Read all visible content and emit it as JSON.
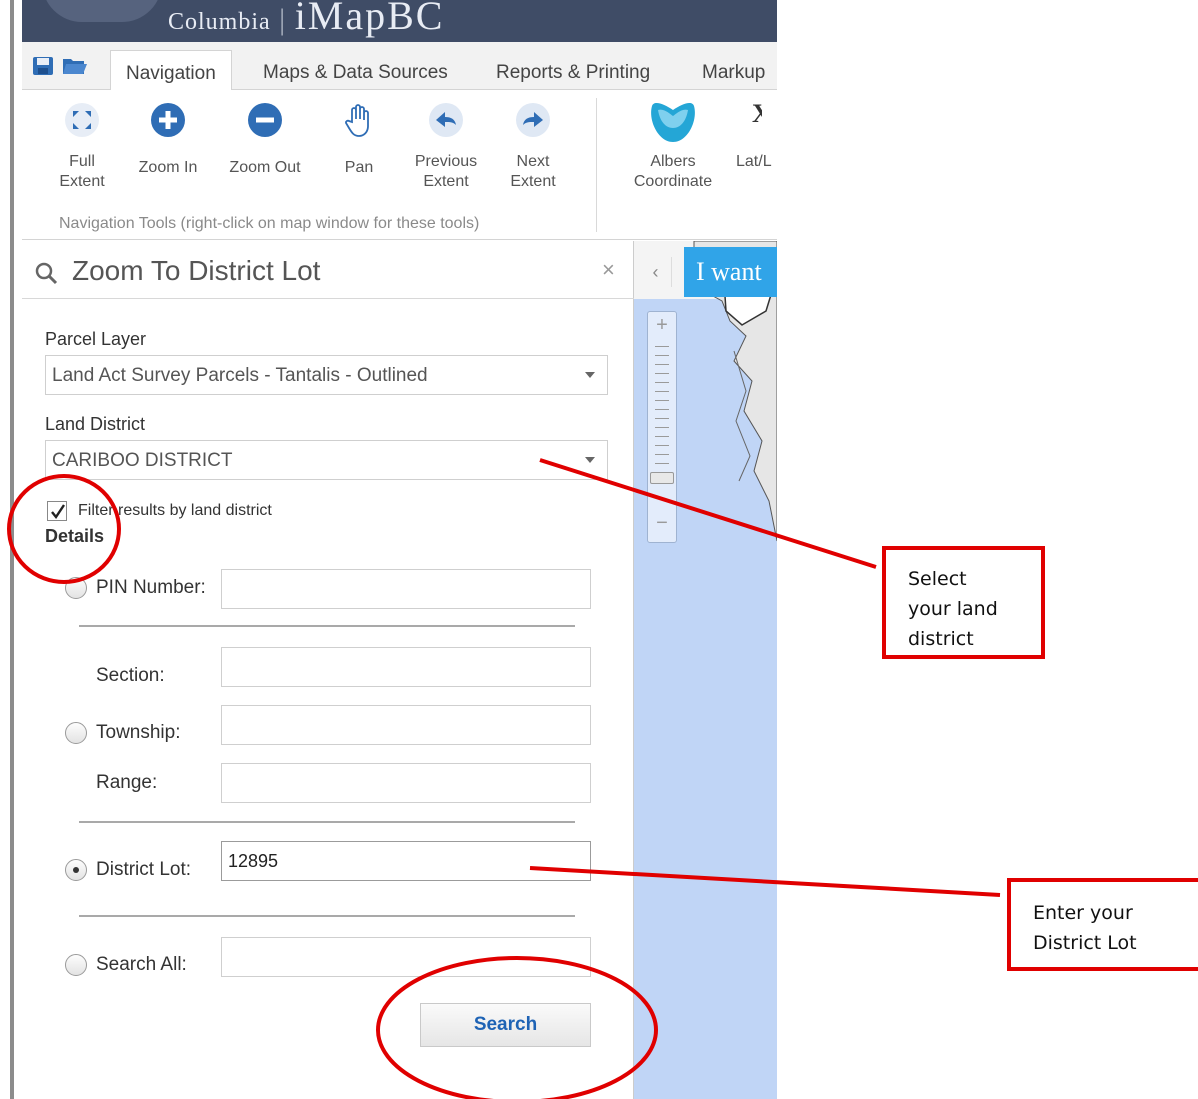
{
  "banner": {
    "text_small": "Columbia",
    "text_big": "iMapBC"
  },
  "ribbon": {
    "tabs": [
      "Navigation",
      "Maps & Data Sources",
      "Reports & Printing",
      "Markup"
    ],
    "tools": [
      {
        "label": "Full Extent",
        "icon": "full-extent-icon"
      },
      {
        "label": "Zoom In",
        "icon": "zoom-in-icon"
      },
      {
        "label": "Zoom Out",
        "icon": "zoom-out-icon"
      },
      {
        "label": "Pan",
        "icon": "pan-hand-icon"
      },
      {
        "label": "Previous Extent",
        "icon": "previous-extent-icon"
      },
      {
        "label": "Next Extent",
        "icon": "next-extent-icon"
      },
      {
        "label": "Albers Coordinate",
        "icon": "albers-coordinate-icon"
      },
      {
        "label": "Lat/L",
        "icon": "lat-long-icon"
      }
    ],
    "group_caption": "Navigation Tools (right-click on map window for these tools)"
  },
  "panel": {
    "title": "Zoom To District Lot",
    "close": "×",
    "parcel_layer": {
      "label": "Parcel Layer",
      "value": "Land Act Survey Parcels - Tantalis - Outlined"
    },
    "land_district": {
      "label": "Land District",
      "value": "CARIBOO DISTRICT"
    },
    "filter": {
      "label": "Filter results by land district",
      "checked": true
    },
    "details_label": "Details",
    "rows": {
      "pin": {
        "label": "PIN Number:",
        "value": ""
      },
      "section": {
        "label": "Section:",
        "value": ""
      },
      "township": {
        "label": "Township:",
        "value": ""
      },
      "range": {
        "label": "Range:",
        "value": ""
      },
      "district_lot": {
        "label": "District Lot:",
        "value": "12895",
        "selected": true
      },
      "search_all": {
        "label": "Search All:",
        "value": ""
      }
    },
    "search_button": "Search"
  },
  "map": {
    "collapse": "‹",
    "i_want": "I want",
    "zoom_plus": "+",
    "zoom_minus": "−"
  },
  "annotations": {
    "land_district_callout": [
      "Select",
      "your land",
      "district"
    ],
    "district_lot_callout": [
      "Enter your",
      "District Lot"
    ],
    "color": "#e00000"
  },
  "colors": {
    "banner": "#3f4c66",
    "accent": "#30a4e8",
    "icon_blue": "#2f6db5",
    "search_text": "#1e63b5"
  }
}
